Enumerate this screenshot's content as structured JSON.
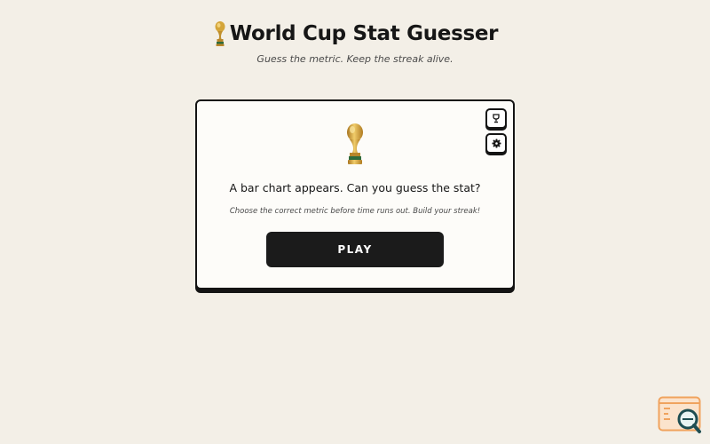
{
  "header": {
    "title": "World Cup Stat Guesser",
    "subtitle": "Guess the metric. Keep the streak alive.",
    "icon": "trophy-icon"
  },
  "card": {
    "icon": "trophy-icon",
    "prompt": "A bar chart appears. Can you guess the stat?",
    "hint": "Choose the correct metric before time runs out. Build your streak!",
    "play_label": "PLAY",
    "corner_buttons": [
      "leaderboard-icon",
      "gear-icon"
    ]
  },
  "colors": {
    "background": "#f3efe7",
    "card": "#fdfcf9",
    "ink": "#141414",
    "gold": "#c9962a",
    "widget_orange": "#f0a35e",
    "widget_teal": "#1f4e52"
  }
}
